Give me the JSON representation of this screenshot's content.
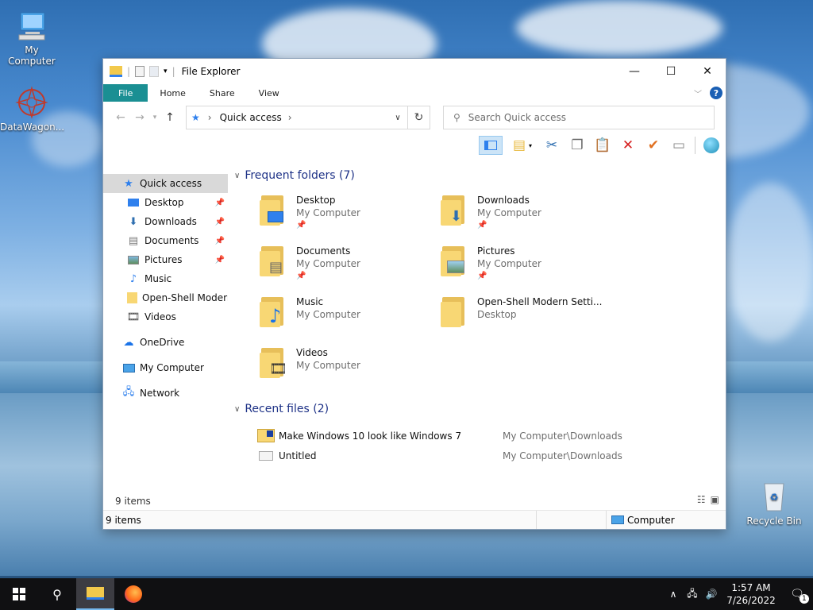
{
  "desktop": {
    "icons": [
      {
        "label": "My Computer",
        "icon": "computer-icon"
      },
      {
        "label": "DataWagon...",
        "icon": "datawagon-icon"
      },
      {
        "label": "Recycle Bin",
        "icon": "recycle-bin-icon"
      }
    ]
  },
  "window": {
    "title": "File Explorer",
    "controls": {
      "minimize": "—",
      "maximize": "☐",
      "close": "✕"
    },
    "ribbon_tabs": [
      "File",
      "Home",
      "Share",
      "View"
    ],
    "help_label": "?",
    "address": {
      "crumb": "Quick access",
      "sep": "›"
    },
    "search_placeholder": "Search Quick access"
  },
  "sidebar": {
    "quick_access": "Quick access",
    "pinned": [
      {
        "label": "Desktop",
        "icon": "desktop-icon",
        "pinned": true
      },
      {
        "label": "Downloads",
        "icon": "downloads-icon",
        "pinned": true
      },
      {
        "label": "Documents",
        "icon": "documents-icon",
        "pinned": true
      },
      {
        "label": "Pictures",
        "icon": "pictures-icon",
        "pinned": true
      },
      {
        "label": "Music",
        "icon": "music-icon",
        "pinned": false
      },
      {
        "label": "Open-Shell Modern",
        "icon": "folder-icon",
        "pinned": false
      },
      {
        "label": "Videos",
        "icon": "videos-icon",
        "pinned": false
      }
    ],
    "onedrive": "OneDrive",
    "my_computer": "My Computer",
    "network": "Network"
  },
  "content": {
    "frequent_header": "Frequent folders (7)",
    "folders": [
      {
        "name": "Desktop",
        "loc": "My Computer",
        "pinned": true,
        "badge": "desktop-icon"
      },
      {
        "name": "Downloads",
        "loc": "My Computer",
        "pinned": true,
        "badge": "downloads-icon"
      },
      {
        "name": "Documents",
        "loc": "My Computer",
        "pinned": true,
        "badge": "documents-icon"
      },
      {
        "name": "Pictures",
        "loc": "My Computer",
        "pinned": true,
        "badge": "pictures-icon"
      },
      {
        "name": "Music",
        "loc": "My Computer",
        "pinned": false,
        "badge": "music-icon"
      },
      {
        "name": "Open-Shell Modern Setti...",
        "loc": "Desktop",
        "pinned": false,
        "badge": "none"
      },
      {
        "name": "Videos",
        "loc": "My Computer",
        "pinned": false,
        "badge": "videos-icon"
      }
    ],
    "recent_header": "Recent files (2)",
    "recent": [
      {
        "name": "Make Windows 10 look like Windows 7",
        "path": "My Computer\\Downloads"
      },
      {
        "name": "Untitled",
        "path": "My Computer\\Downloads"
      }
    ],
    "items_count": "9 items"
  },
  "statusbar": {
    "items": "9 items",
    "location": "Computer"
  },
  "taskbar": {
    "time": "1:57 AM",
    "date": "7/26/2022",
    "notification_count": "1"
  },
  "colors": {
    "accent": "#1a8f93",
    "header_text": "#1e3287",
    "folder": "#f8d774"
  }
}
